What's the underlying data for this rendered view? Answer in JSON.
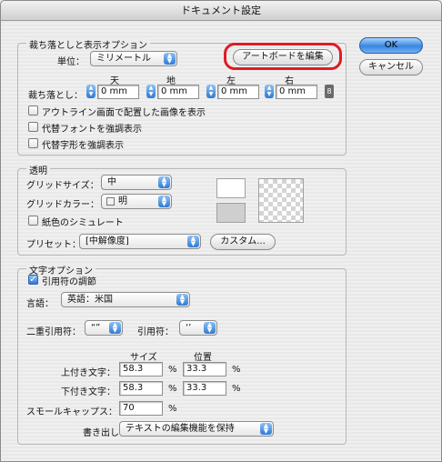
{
  "window": {
    "title": "ドキュメント設定"
  },
  "buttons": {
    "ok": "OK",
    "cancel": "キャンセル",
    "edit_artboards": "アートボードを編集",
    "custom": "カスタム..."
  },
  "bleed_view": {
    "legend": "裁ち落としと表示オプション",
    "units_label": "単位：",
    "units_value": "ミリメートル",
    "col_top": "天",
    "col_bottom": "地",
    "col_left": "左",
    "col_right": "右",
    "bleed_label": "裁ち落とし：",
    "bleed_top": "0 mm",
    "bleed_bottom": "0 mm",
    "bleed_left": "0 mm",
    "bleed_right": "0 mm",
    "checkboxes": [
      {
        "label": "アウトライン画面で配置した画像を表示",
        "checked": false
      },
      {
        "label": "代替フォントを強調表示",
        "checked": false
      },
      {
        "label": "代替字形を強調表示",
        "checked": false
      }
    ]
  },
  "transparency": {
    "legend": "透明",
    "grid_size_label": "グリッドサイズ：",
    "grid_size_value": "中",
    "grid_color_label": "グリッドカラー：",
    "grid_color_value": "明",
    "simulate_paper_label": "紙色のシミュレート",
    "simulate_paper_checked": false,
    "preset_label": "プリセット：",
    "preset_value": "[中解像度]"
  },
  "type_options": {
    "legend": "文字オプション",
    "smart_quotes_label": "引用符の調節",
    "smart_quotes_checked": true,
    "language_label": "言語：",
    "language_value": "英語：米国",
    "double_quotes_label": "二重引用符：",
    "double_quotes_value": "“”",
    "single_quotes_label": "引用符：",
    "single_quotes_value": "‘’",
    "size_header": "サイズ",
    "position_header": "位置",
    "superscript_label": "上付き文字：",
    "superscript_size": "58.3",
    "superscript_position": "33.3",
    "subscript_label": "下付き文字：",
    "subscript_size": "58.3",
    "subscript_position": "33.3",
    "small_caps_label": "スモールキャップス：",
    "small_caps_value": "70",
    "percent": "%",
    "export_label": "書き出し：",
    "export_value": "テキストの編集機能を保持"
  }
}
